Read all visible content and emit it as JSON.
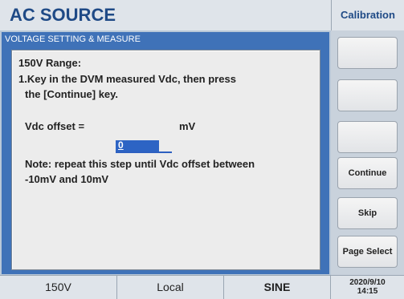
{
  "header": {
    "app_title": "AC SOURCE",
    "mode_title": "Calibration"
  },
  "dialog": {
    "title": "VOLTAGE SETTING & MEASURE",
    "range_label": "150V Range:",
    "instruction_line1": "1.Key in the DVM measured Vdc, then press",
    "instruction_line2": "the [Continue] key.",
    "offset_label": "Vdc offset =",
    "offset_value": "0",
    "offset_unit": "mV",
    "note_line1": "Note: repeat this step until Vdc offset between",
    "note_line2": "-10mV and 10mV"
  },
  "softkeys": {
    "key1": "",
    "key2": "",
    "key3": "",
    "continue": "Continue",
    "skip": "Skip",
    "page_select": "Page Select"
  },
  "status_bar": {
    "range": "150V",
    "control": "Local",
    "waveform": "SINE",
    "date": "2020/9/10",
    "time": "14:15"
  },
  "colors": {
    "accent_blue": "#3f72b8",
    "title_blue": "#1f4a86",
    "input_highlight": "#2d64c4"
  }
}
